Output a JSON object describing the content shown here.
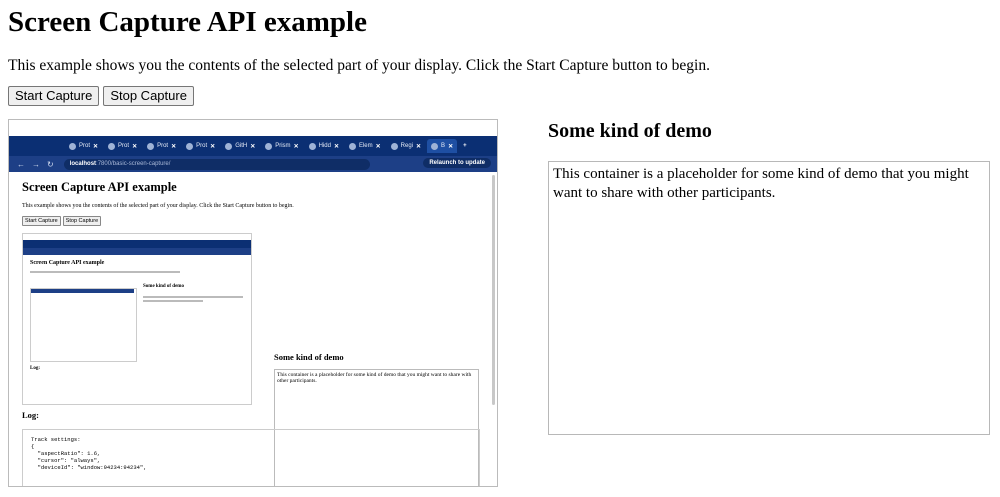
{
  "page": {
    "title": "Screen Capture API example",
    "intro": "This example shows you the contents of the selected part of your display. Click the Start Capture button to begin."
  },
  "controls": {
    "start_label": "Start Capture",
    "stop_label": "Stop Capture"
  },
  "demo": {
    "heading": "Some kind of demo",
    "text": "This container is a placeholder for some kind of demo that you might want to share with other participants."
  },
  "capture": {
    "tabs": [
      {
        "label": "Prot",
        "icon": "globe-icon"
      },
      {
        "label": "Prot",
        "icon": "globe-icon"
      },
      {
        "label": "Prot",
        "icon": "globe-icon"
      },
      {
        "label": "Prot",
        "icon": "globe-icon"
      },
      {
        "label": "GitH",
        "icon": "github-icon"
      },
      {
        "label": "Prism",
        "icon": "globe-icon"
      },
      {
        "label": "Hidd",
        "icon": "globe-icon"
      },
      {
        "label": "Elem",
        "icon": "globe-icon"
      },
      {
        "label": "Regi",
        "icon": "globe-icon"
      },
      {
        "label": "B",
        "icon": "globe-icon"
      }
    ],
    "url_host": "localhost",
    "url_path": ":7800/basic-screen-capture/",
    "relaunch_label": "Relaunch to update",
    "inner_title": "Screen Capture API example",
    "inner_intro": "This example shows you the contents of the selected part of your display. Click the Start Capture button to begin.",
    "inner_start": "Start Capture",
    "inner_stop": "Stop Capture",
    "inner_demo_heading": "Some kind of demo",
    "inner_demo_text": "This container is a placeholder for some kind of demo that you might want to share with other participants.",
    "inner_log_heading": "Log:",
    "inner_log_text": "Track settings:\n{\n  \"aspectRatio\": 1.6,\n  \"cursor\": \"always\",\n  \"deviceId\": \"window:94234:94234\","
  },
  "colors": {
    "tabbar": "#0b2f73",
    "addressbar": "#1d3f86"
  }
}
